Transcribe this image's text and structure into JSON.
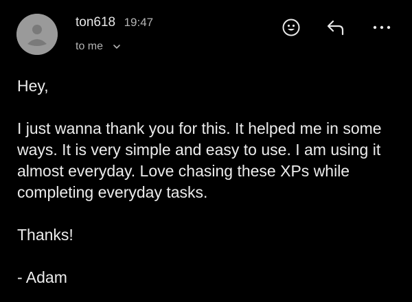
{
  "sender": {
    "name": "ton618",
    "time": "19:47",
    "recipient": "to me"
  },
  "icons": {
    "avatar": "avatar-placeholder-icon",
    "recipient_toggle": "chevron-down-icon",
    "emoji": "emoji-reaction-icon",
    "reply": "reply-icon",
    "more": "more-options-icon"
  },
  "colors": {
    "background": "#000000",
    "text": "#ececec",
    "secondary_text": "#b5b5b5",
    "avatar_bg": "#9a9a9a"
  },
  "message": {
    "greeting": "Hey,",
    "paragraph": "I just wanna thank you for this. It helped me in some ways. It is very simple and easy to use. I am using it almost everyday. Love chasing these XPs while completing everyday tasks.",
    "closing": "Thanks!",
    "signature": "- Adam"
  }
}
